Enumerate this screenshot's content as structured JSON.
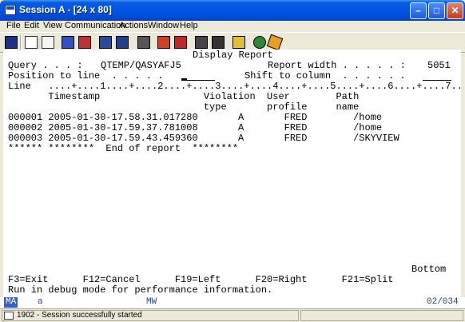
{
  "window": {
    "title": "Session A - [24 x 80]"
  },
  "menu": [
    "File",
    "Edit",
    "View",
    "Communication",
    "Actions",
    "Window",
    "Help"
  ],
  "toolbar_icons": [
    "print-screen-icon",
    "copy-icon",
    "paste-icon",
    "send-file-icon",
    "receive-file-icon",
    "display-icon",
    "keyboard-icon",
    "macro-play-icon",
    "macro-record-icon",
    "macro-stop-icon",
    "macro-edit-icon",
    "clipboard-icon",
    "help-globe-icon",
    "help-tag-icon"
  ],
  "screen": {
    "title": "Display Report",
    "query_label": "Query . . . :",
    "query_value": "QTEMP/QASYAFJ5",
    "report_width_label": "Report width . . . . . :",
    "report_width_value": "5051",
    "position_label": "Position to line  . . . . .",
    "position_value": "",
    "shift_label": "Shift to column  . . . . . .",
    "shift_value": "",
    "ruler": "Line   ....+....1....+....2....+....3....+....4....+....5....+....6....+....7..",
    "header1": "       Timestamp                  Violation  User        Path",
    "header2": "                                  type       profile     name",
    "rows": [
      "000001 2005-01-30-17.58.31.017280       A       FRED        /home",
      "000002 2005-01-30-17.59.37.781008       A       FRED        /home",
      "000003 2005-01-30-17.59.43.459360       A       FRED        /SKYVIEW"
    ],
    "end_line": "****** ********  End of report  ********",
    "bottom": "Bottom",
    "fkeys": "F3=Exit      F12=Cancel      F19=Left      F20=Right      F21=Split",
    "message": "Run in debug mode for performance information."
  },
  "oia": {
    "left": "MA",
    "mode": "a",
    "mw": "MW",
    "pos": "02/034"
  },
  "status": {
    "text": "1902 - Session successfully started"
  }
}
